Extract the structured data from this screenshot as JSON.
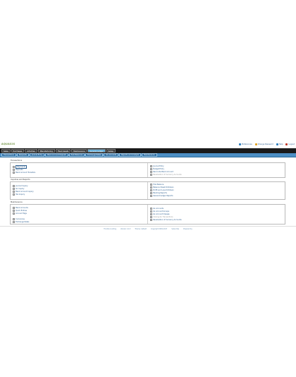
{
  "app": {
    "logo": "AQUASIX"
  },
  "toplinks": [
    {
      "label": "Preferences",
      "icon": "preferences-icon",
      "color": "#2f7fbf"
    },
    {
      "label": "Change Password",
      "icon": "key-icon",
      "color": "#e0a020"
    },
    {
      "label": "Help",
      "icon": "help-icon",
      "color": "#2f7fbf"
    },
    {
      "label": "Logout",
      "icon": "logout-icon",
      "color": "#c0392b"
    }
  ],
  "mainnav": [
    {
      "label": "Sales"
    },
    {
      "label": "Purchases"
    },
    {
      "label": "Activities"
    },
    {
      "label": "Manufacturing"
    },
    {
      "label": "Fixed Assets"
    },
    {
      "label": "Maintenance"
    },
    {
      "label": "General Ledger"
    },
    {
      "label": "Setup"
    }
  ],
  "subnav": [
    {
      "label": "Transactions"
    },
    {
      "label": "Requests"
    },
    {
      "label": "Journal Entry"
    },
    {
      "label": "Bank Account Deposit"
    },
    {
      "label": "Post Balances"
    },
    {
      "label": "Exchange Rates"
    },
    {
      "label": "GL Accounts"
    },
    {
      "label": "Reports and Analysis"
    },
    {
      "label": "Maintenance"
    }
  ],
  "sections": [
    {
      "title": "Transactions",
      "left": [
        "Payments",
        "Deposits",
        "Bank Account Transfers"
      ],
      "right": [
        "Journal Entry",
        "Budget Entry",
        "Reconcile Bank Account",
        "Revaluation of Currency Accounts"
      ]
    },
    {
      "title": "Inquiries and Reports",
      "left": [
        "Journal Inquiry",
        "GL Inquiry",
        "Bank Account Inquiry",
        "Tax Inquiry"
      ],
      "right": [
        "Trial Balance",
        "Balance Sheet Drilldown",
        "Profit and Loss Drilldown",
        "Banking Reports",
        "General Ledger Reports"
      ]
    },
    {
      "title": "Maintenance",
      "left": [
        "Bank Accounts",
        "Quick Entries",
        "Account Tags",
        "",
        "Currencies",
        "Exchange Rates"
      ],
      "right": [
        "GL Accounts",
        "GL Account Groups",
        "GL Account Classes",
        "Closing GL Transactions",
        "Revaluation of Currency Accounts"
      ]
    }
  ],
  "footer": [
    "FrontAccounting",
    "Version 2.4.3",
    "Theme: default",
    "Copyright 2009-2017",
    "Subscribe",
    "Powered by"
  ]
}
